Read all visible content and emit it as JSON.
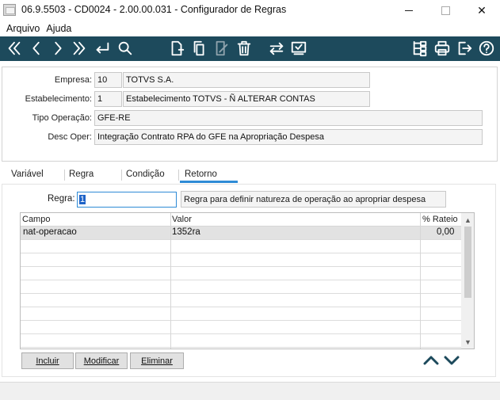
{
  "window": {
    "title": "06.9.5503 - CD0024 - 2.00.00.031 - Configurador de Regras",
    "close_glyph": "✕"
  },
  "menu": {
    "items": [
      "Arquivo",
      "Ajuda"
    ]
  },
  "toolbar": {
    "color": "#1d4a5c",
    "icons": [
      "first-icon",
      "previous-icon",
      "next-icon",
      "last-icon",
      "goto-icon",
      "search-icon",
      "new-icon",
      "copy-icon",
      "edit-icon",
      "delete-icon",
      "exchange-icon",
      "confirm-icon",
      "tree-icon",
      "print-icon",
      "exit-icon",
      "help-icon"
    ]
  },
  "header": {
    "empresa": {
      "label": "Empresa:",
      "code": "10",
      "name": "TOTVS S.A."
    },
    "estabelecimento": {
      "label": "Estabelecimento:",
      "code": "1",
      "name": "Estabelecimento TOTVS - Ñ ALTERAR CONTAS"
    },
    "tipo_operacao": {
      "label": "Tipo Operação:",
      "value": "GFE-RE"
    },
    "desc_oper": {
      "label": "Desc Oper:",
      "value": "Integração Contrato RPA do GFE na Apropriação Despesa"
    }
  },
  "tabs": {
    "items": [
      "Variável",
      "Regra",
      "Condição",
      "Retorno"
    ],
    "active": "Retorno",
    "active_color": "#2e8bd6"
  },
  "retorno": {
    "regra_label": "Regra:",
    "regra_value": "1",
    "regra_desc": "Regra para definir natureza de operação ao apropriar despesa",
    "grid": {
      "columns": [
        "Campo",
        "Valor",
        "% Rateio"
      ],
      "rows": [
        {
          "campo": "nat-operacao",
          "valor": "1352ra",
          "rateio": "0,00"
        }
      ]
    },
    "buttons": {
      "incluir": "Incluir",
      "modificar": "Modificar",
      "eliminar": "Eliminar"
    }
  }
}
